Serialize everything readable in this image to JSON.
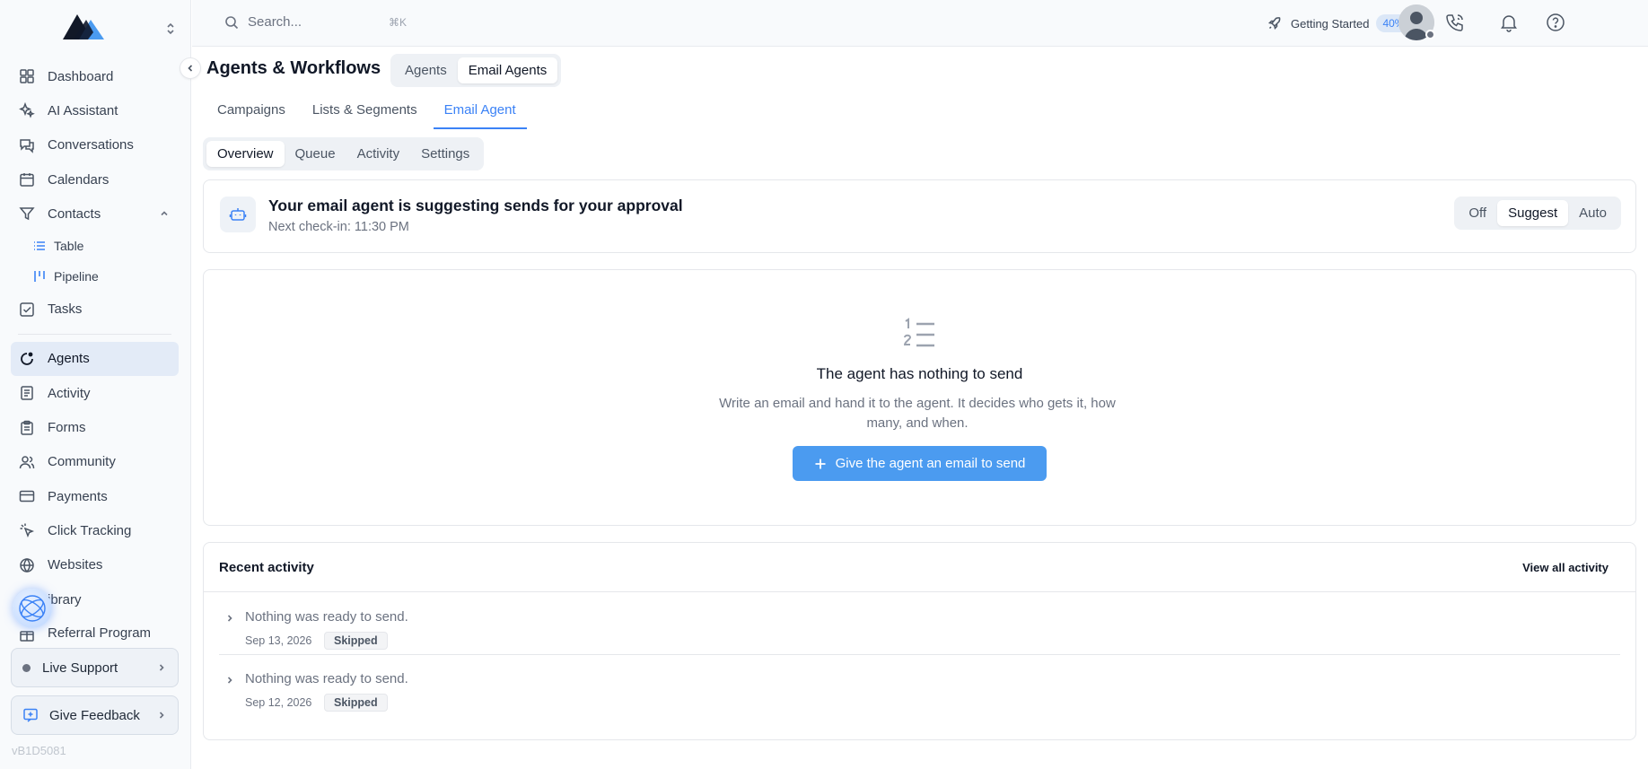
{
  "sidebar": {
    "items": [
      {
        "label": "Dashboard",
        "icon": "dashboard-icon"
      },
      {
        "label": "AI Assistant",
        "icon": "sparkles-icon"
      },
      {
        "label": "Conversations",
        "icon": "chat-icon"
      },
      {
        "label": "Calendars",
        "icon": "calendar-icon"
      },
      {
        "label": "Contacts",
        "icon": "filter-icon"
      },
      {
        "label": "Table",
        "icon": "list-icon"
      },
      {
        "label": "Pipeline",
        "icon": "pipeline-icon"
      },
      {
        "label": "Tasks",
        "icon": "checkbox-icon"
      },
      {
        "label": "Agents",
        "icon": "agents-icon"
      },
      {
        "label": "Activity",
        "icon": "document-icon"
      },
      {
        "label": "Forms",
        "icon": "clipboard-icon"
      },
      {
        "label": "Community",
        "icon": "users-icon"
      },
      {
        "label": "Payments",
        "icon": "credit-card-icon"
      },
      {
        "label": "Click Tracking",
        "icon": "pointer-icon"
      },
      {
        "label": "Websites",
        "icon": "globe-icon"
      },
      {
        "label": "ibrary",
        "icon": "book-icon"
      },
      {
        "label": "Referral Program",
        "icon": "gift-icon"
      }
    ],
    "live_support": "Live Support",
    "give_feedback": "Give Feedback",
    "version": "vB1D5081"
  },
  "topbar": {
    "search_placeholder": "Search...",
    "search_shortcut": "⌘K",
    "getting_started": "Getting Started",
    "progress_pct": "40%"
  },
  "main": {
    "title": "Agents & Workflows",
    "segment": [
      "Agents",
      "Email Agents"
    ],
    "tabs": [
      "Campaigns",
      "Lists & Segments",
      "Email Agent"
    ],
    "subtabs": [
      "Overview",
      "Queue",
      "Activity",
      "Settings"
    ],
    "status": {
      "title": "Your email agent is suggesting sends for your approval",
      "subtitle": "Next check-in: 11:30 PM",
      "modes": [
        "Off",
        "Suggest",
        "Auto"
      ],
      "selected_mode": "Suggest"
    },
    "empty": {
      "title": "The agent has nothing to send",
      "description": "Write an email and hand it to the agent. It decides who gets it, how many, and when.",
      "button": "Give the agent an email to send"
    },
    "recent": {
      "title": "Recent activity",
      "view_all": "View all activity",
      "rows": [
        {
          "message": "Nothing was ready to send.",
          "date": "Sep 13, 2026",
          "badge": "Skipped"
        },
        {
          "message": "Nothing was ready to send.",
          "date": "Sep 12, 2026",
          "badge": "Skipped"
        }
      ]
    }
  },
  "colors": {
    "accent": "#3b82f6",
    "button": "#4b9bf0",
    "active_nav": "#e3ebf7"
  }
}
